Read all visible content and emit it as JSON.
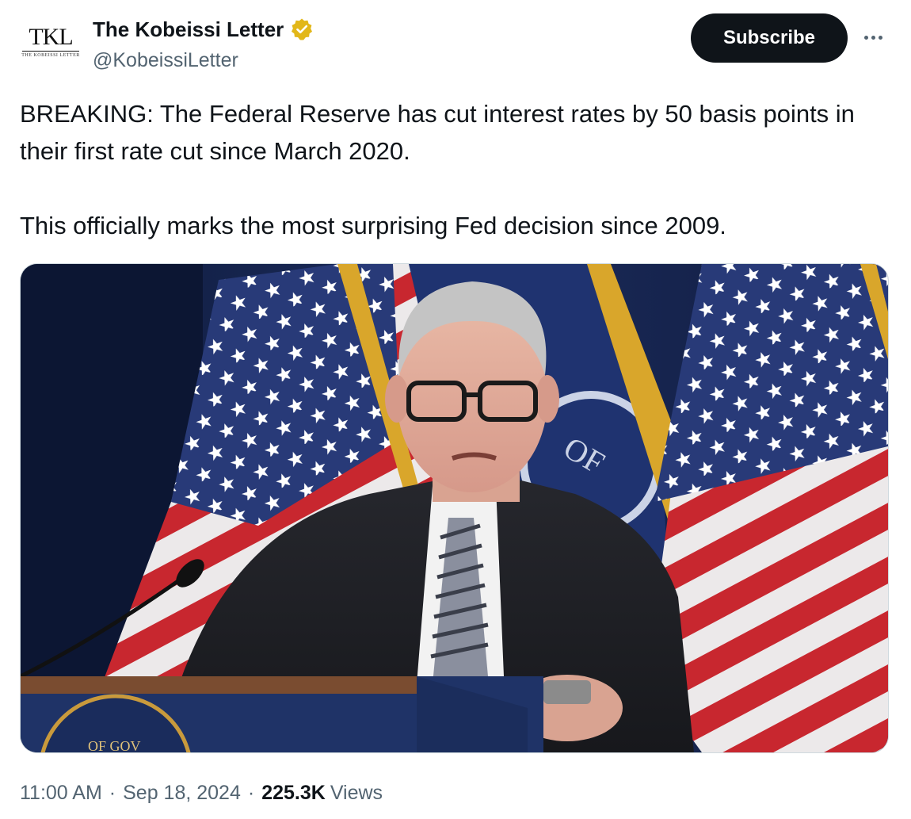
{
  "author": {
    "display_name": "The Kobeissi Letter",
    "handle": "@KobeissiLetter",
    "avatar_monogram": "TKL",
    "avatar_subtitle": "THE KOBEISSI LETTER",
    "verified_badge": "verified-gold-icon"
  },
  "actions": {
    "subscribe_label": "Subscribe",
    "more_icon": "more-horizontal-icon"
  },
  "tweet": {
    "paragraph_1": "BREAKING: The Federal Reserve has cut interest rates by 50 basis points in their first rate cut since March 2020.",
    "paragraph_2": "This officially marks the most surprising Fed decision since 2009."
  },
  "media": {
    "seal_text": "OF GOV",
    "flag_seal_text": "OF"
  },
  "footer": {
    "time": "11:00 AM",
    "separator": "·",
    "date": "Sep 18, 2024",
    "views_count": "225.3K",
    "views_label": "Views"
  },
  "colors": {
    "text_primary": "#0f1419",
    "text_secondary": "#536471",
    "button_bg": "#0f1419",
    "verified_gold": "#e2b719"
  }
}
